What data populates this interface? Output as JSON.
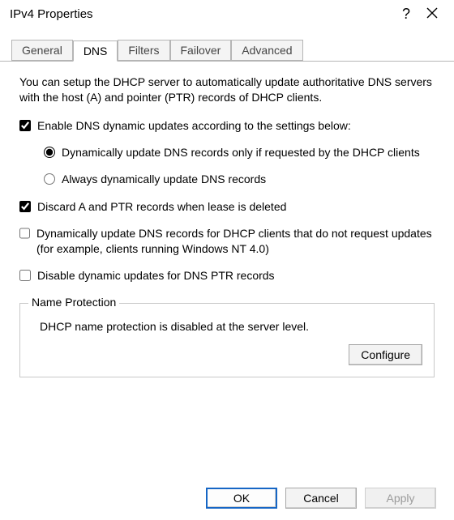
{
  "window": {
    "title": "IPv4 Properties"
  },
  "tabs": {
    "general": "General",
    "dns": "DNS",
    "filters": "Filters",
    "failover": "Failover",
    "advanced": "Advanced",
    "active": "dns"
  },
  "dnspane": {
    "intro": "You can setup the DHCP server to automatically update authoritative DNS servers with the host (A) and pointer (PTR) records of DHCP clients.",
    "enable": {
      "label": "Enable DNS dynamic updates according to the settings below:",
      "checked": true
    },
    "updateMode": {
      "option_requested": "Dynamically update DNS records only if requested by the DHCP clients",
      "option_always": "Always dynamically update DNS records",
      "value": "requested"
    },
    "discard": {
      "label": "Discard A and PTR records when lease is deleted",
      "checked": true
    },
    "legacy": {
      "label": "Dynamically update DNS records for DHCP clients that do not request updates (for example, clients running Windows NT 4.0)",
      "checked": false
    },
    "disablePtr": {
      "label": "Disable dynamic updates for DNS PTR records",
      "checked": false
    },
    "nameProtection": {
      "legend": "Name Protection",
      "body": "DHCP name protection is disabled at the server level.",
      "configure": "Configure"
    }
  },
  "buttons": {
    "ok": "OK",
    "cancel": "Cancel",
    "apply": "Apply"
  }
}
